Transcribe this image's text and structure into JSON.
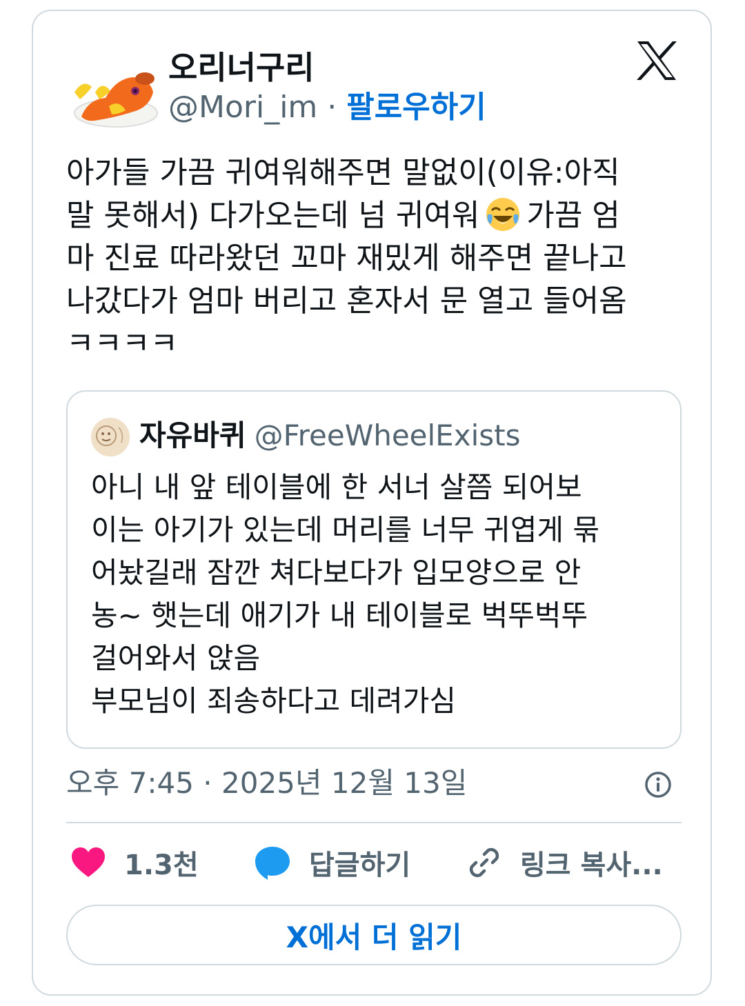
{
  "author": {
    "name": "오리너구리",
    "handle": "@Mori_im",
    "separator": "·",
    "follow_label": "팔로우하기"
  },
  "tweet": {
    "text_before_emoji": "아가들 가끔 귀여워해주면 말없이(이유:아직\n말 못해서) 다가오는데 넘 귀여워",
    "emoji": "face-with-tears-of-joy",
    "text_after_emoji": "가끔 엄\n마 진료 따라왔던 꼬마 재밌게 해주면 끝나고\n나갔다가 엄마 버리고 혼자서 문 열고 들어옴\nㅋㅋㅋㅋ"
  },
  "quoted_tweet": {
    "name": "자유바퀴",
    "handle": "@FreeWheelExists",
    "text": "아니 내 앞 테이블에 한 서너 살쯤 되어보\n이는 아기가 있는데 머리를 너무 귀엽게 묶\n어놨길래 잠깐 쳐다보다가 입모양으로 안\n농~ 햇는데 애기가 내 테이블로 벅뚜벅뚜\n걸어와서 앉음\n부모님이 죄송하다고 데려가심"
  },
  "timestamp": "오후 7:45 · 2025년 12월 13일",
  "actions": {
    "like_count": "1.3천",
    "reply_label": "답글하기",
    "copy_link_label": "링크 복사..."
  },
  "read_more_label": "X에서 더 읽기",
  "colors": {
    "link_blue": "#006fd6",
    "like_pink": "#f91880",
    "reply_blue": "#1d9bf0",
    "muted_gray": "#536471",
    "border": "#cfd9de"
  }
}
